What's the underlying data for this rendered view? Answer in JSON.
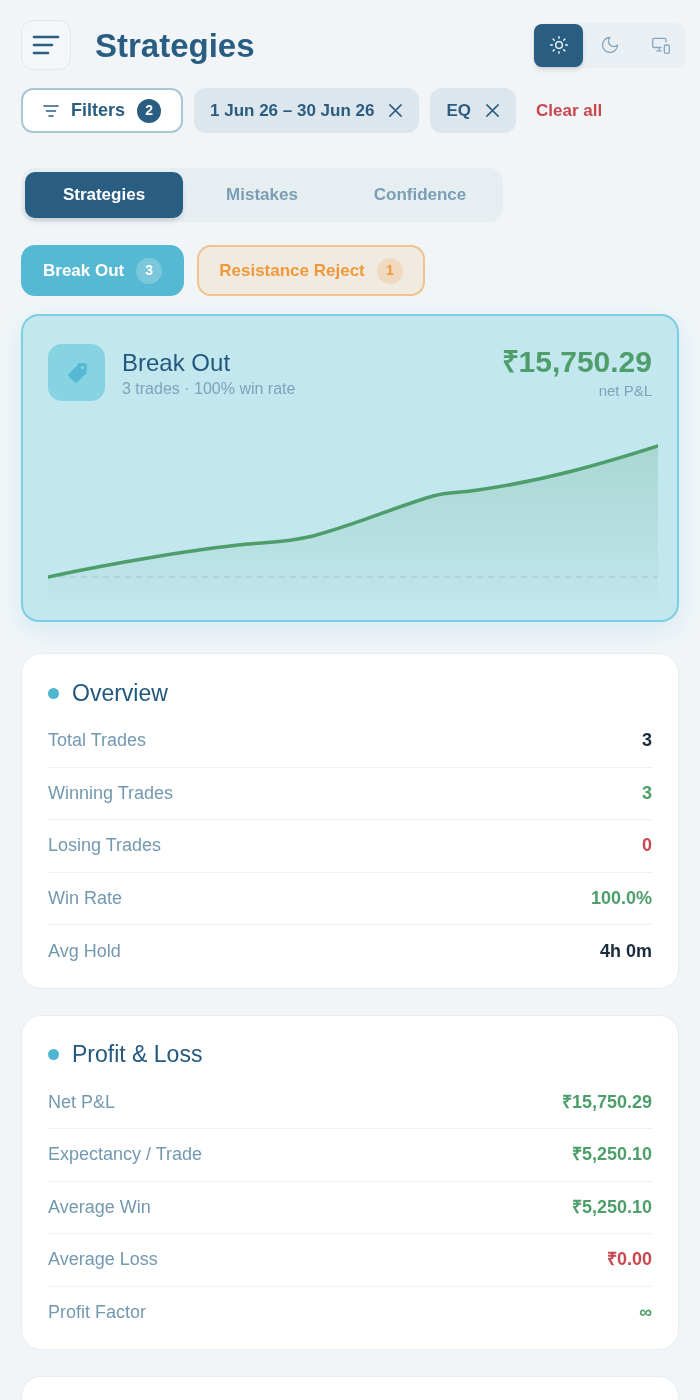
{
  "header": {
    "title": "Strategies",
    "theme_toggle": [
      {
        "kind": "light",
        "selected": true
      },
      {
        "kind": "dark",
        "selected": false
      },
      {
        "kind": "system",
        "selected": false
      }
    ]
  },
  "filters": {
    "button": {
      "label": "Filters",
      "count": "2"
    },
    "chips": [
      {
        "label": "1 Jun 26 – 30 Jun 26"
      },
      {
        "label": "EQ"
      }
    ],
    "clear": "Clear all"
  },
  "tabs": [
    {
      "label": "Strategies",
      "selected": true
    },
    {
      "label": "Mistakes",
      "selected": false
    },
    {
      "label": "Confidence",
      "selected": false
    }
  ],
  "strategies": [
    {
      "label": "Break Out",
      "count": "3",
      "color": "#56b9d3",
      "selected": true
    },
    {
      "label": "Resistance Reject",
      "count": "1",
      "color": "#f0993a",
      "selected": false
    }
  ],
  "summary": {
    "title": "Break Out",
    "subtitle": "3 trades · 100% win rate",
    "amount": "₹15,750.29",
    "amount_label": "net P&L"
  },
  "sections": [
    {
      "title": "Overview",
      "rows": [
        {
          "label": "Total Trades",
          "value": "3",
          "color": "#1b2b3a"
        },
        {
          "label": "Winning Trades",
          "value": "3",
          "color": "#4d9e6a"
        },
        {
          "label": "Losing Trades",
          "value": "0",
          "color": "#c9474f"
        },
        {
          "label": "Win Rate",
          "value": "100.0%",
          "color": "#4d9e6a"
        },
        {
          "label": "Avg Hold",
          "value": "4h 0m",
          "color": "#1b2b3a"
        }
      ]
    },
    {
      "title": "Profit & Loss",
      "rows": [
        {
          "label": "Net P&L",
          "value": "₹15,750.29",
          "color": "#4d9e6a"
        },
        {
          "label": "Expectancy / Trade",
          "value": "₹5,250.10",
          "color": "#4d9e6a"
        },
        {
          "label": "Average Win",
          "value": "₹5,250.10",
          "color": "#4d9e6a"
        },
        {
          "label": "Average Loss",
          "value": "₹0.00",
          "color": "#c9474f"
        },
        {
          "label": "Profit Factor",
          "value": "∞",
          "color": "#4d9e6a"
        }
      ]
    }
  ]
}
